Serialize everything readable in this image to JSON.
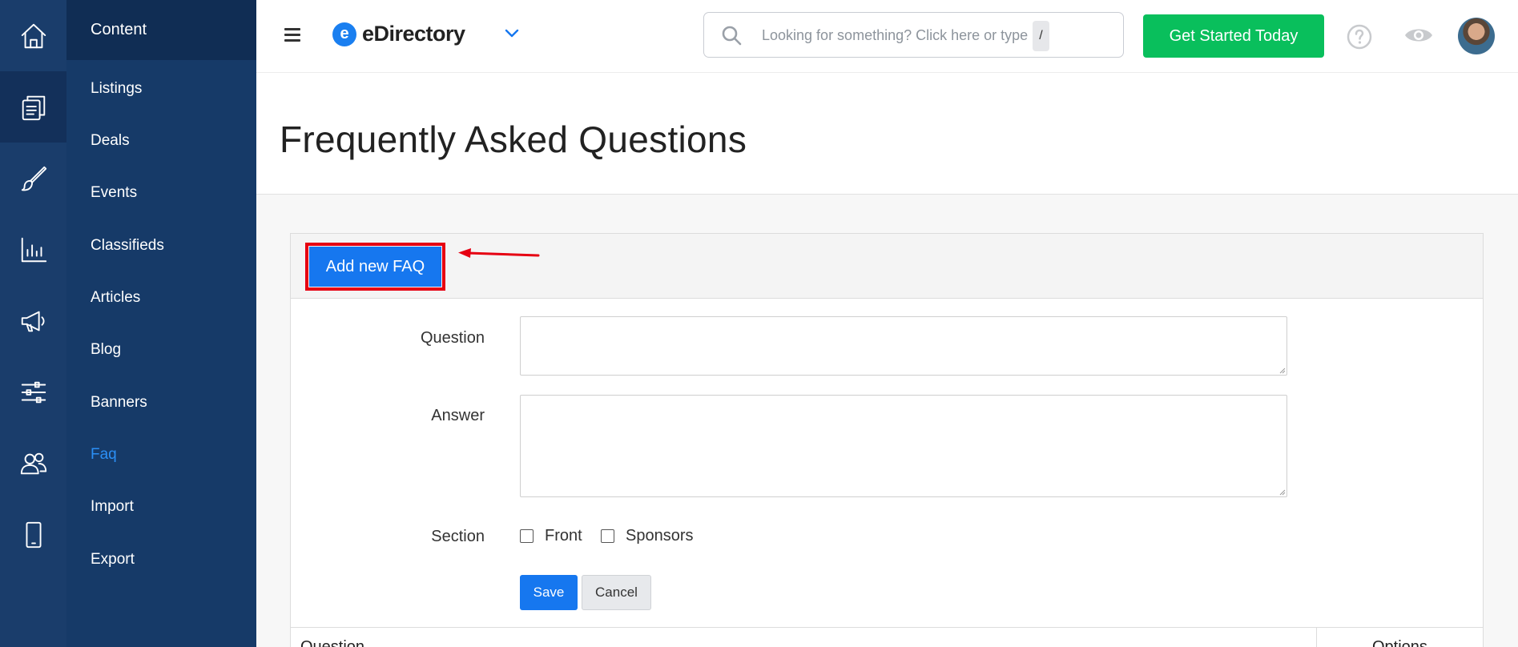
{
  "sidebar": {
    "section_title": "Content",
    "rail_icons": [
      "home-icon",
      "content-icon",
      "design-icon",
      "reports-icon",
      "promote-icon",
      "settings-icon",
      "users-icon",
      "mobile-icon"
    ],
    "items": [
      {
        "label": "Listings"
      },
      {
        "label": "Deals"
      },
      {
        "label": "Events"
      },
      {
        "label": "Classifieds"
      },
      {
        "label": "Articles"
      },
      {
        "label": "Blog"
      },
      {
        "label": "Banners"
      },
      {
        "label": "Faq",
        "active": true
      },
      {
        "label": "Import"
      },
      {
        "label": "Export"
      }
    ]
  },
  "header": {
    "logo_letter": "e",
    "logo_text": "eDirectory",
    "search_placeholder": "Looking for something? Click here or type",
    "search_shortcut": "/",
    "cta_label": "Get Started Today"
  },
  "page": {
    "title": "Frequently Asked Questions"
  },
  "form": {
    "add_button_label": "Add new FAQ",
    "question_label": "Question",
    "answer_label": "Answer",
    "section_label": "Section",
    "section_options": [
      "Front",
      "Sponsors"
    ],
    "save_label": "Save",
    "cancel_label": "Cancel"
  },
  "table": {
    "columns": [
      "Question",
      "Options"
    ]
  },
  "colors": {
    "rail_bg": "#1a3d6b",
    "submenu_bg": "#163a68",
    "active_link": "#2b8ff5",
    "primary": "#1677ef",
    "cta": "#09bf5c",
    "highlight": "#e60012"
  }
}
